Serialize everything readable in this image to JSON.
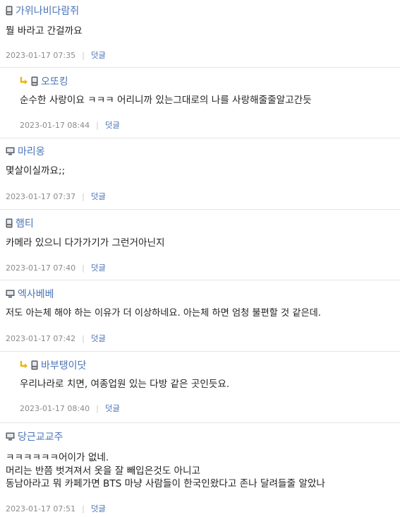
{
  "reply_label": "덧글",
  "separator": "|",
  "comments": [
    {
      "nick": "가위나비다람쥐",
      "device": "mobile",
      "reply": false,
      "text": [
        "뭘  바라고 간걸까요"
      ],
      "time": "2023-01-17 07:35"
    },
    {
      "nick": "오또킹",
      "device": "mobile",
      "reply": true,
      "text": [
        "순수한 사랑이요 ㅋㅋㅋ 어리니까 있는그대로의 나를 사랑해줄줄알고간듯"
      ],
      "time": "2023-01-17 08:44"
    },
    {
      "nick": "마리옹",
      "device": "pc",
      "reply": false,
      "text": [
        "몇살이실까요;;"
      ],
      "time": "2023-01-17 07:37"
    },
    {
      "nick": "햄티",
      "device": "mobile",
      "reply": false,
      "text": [
        "카메라 있으니 다가가기가 그런거아닌지"
      ],
      "time": "2023-01-17 07:40"
    },
    {
      "nick": "엑사베베",
      "device": "pc",
      "reply": false,
      "text": [
        "저도 아는체 해야 하는 이유가 더 이상하네요. 아는체 하면 엄청 불편할 것 같은데."
      ],
      "time": "2023-01-17 07:42"
    },
    {
      "nick": "바부탱이닷",
      "device": "mobile",
      "reply": true,
      "text": [
        "우리나라로 치면, 여종업원 있는 다방 같은 곳인듯요."
      ],
      "time": "2023-01-17 08:40"
    },
    {
      "nick": "당근교교주",
      "device": "pc",
      "reply": false,
      "text": [
        "ㅋㅋㅋㅋㅋㅋ어이가 없네.",
        "머리는 반쯤 벗겨져서 옷을 잘 빼입은것도 아니고",
        "동남아라고 뭐 카페가면 BTS 마냥 사람들이 한국인왔다고 존나 달려들줄 알았나"
      ],
      "time": "2023-01-17 07:51"
    }
  ],
  "colors": {
    "nick": "#4a74b8",
    "meta": "#8b8b8b",
    "reply_arrow": "#f0b400"
  }
}
